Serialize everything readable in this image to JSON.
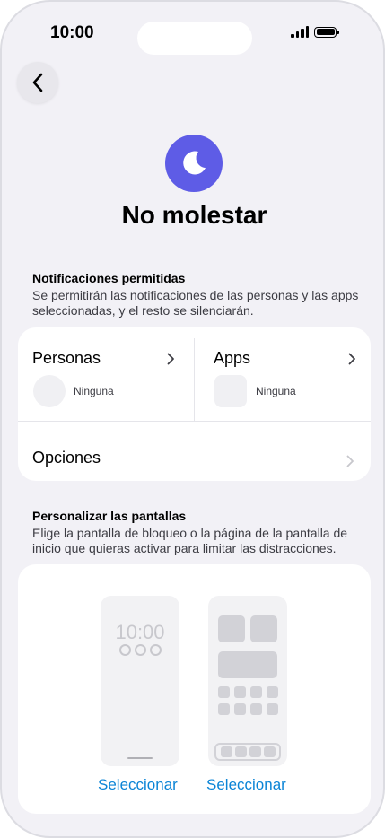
{
  "status_bar": {
    "time": "10:00"
  },
  "header": {
    "title": "No molestar"
  },
  "notifications": {
    "heading": "Notificaciones permitidas",
    "description": "Se permitirán las notificaciones de las personas y las apps seleccionadas, y el resto se silenciarán.",
    "people": {
      "label": "Personas",
      "value": "Ninguna"
    },
    "apps": {
      "label": "Apps",
      "value": "Ninguna"
    },
    "options_label": "Opciones"
  },
  "customize": {
    "heading": "Personalizar las pantallas",
    "description": "Elige la pantalla de bloqueo o la página de la pantalla de inicio que quieras activar para limitar las distracciones.",
    "lock_screen": {
      "time": "10:00",
      "select_label": "Seleccionar"
    },
    "home_screen": {
      "select_label": "Seleccionar"
    }
  },
  "colors": {
    "accent": "#5e5ce6",
    "link": "#0a84d6",
    "background": "#f2f1f6"
  },
  "icons": [
    "back-chevron-icon",
    "moon-icon",
    "chevron-right-icon",
    "signal-icon",
    "battery-icon"
  ]
}
